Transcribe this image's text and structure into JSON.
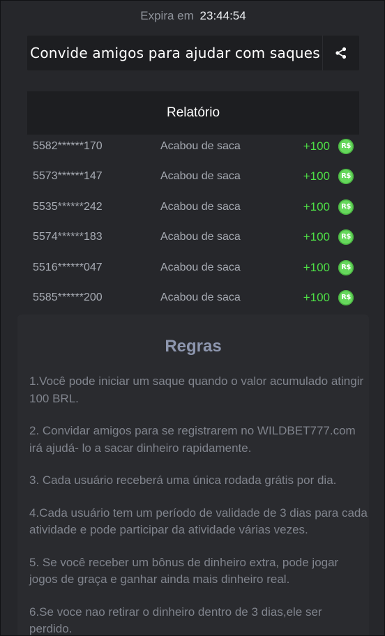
{
  "header": {
    "expira_label": "Expira em",
    "countdown": "23:44:54"
  },
  "invite": {
    "label": "Convide amigos para ajudar com saques",
    "share_icon": "share-icon"
  },
  "report": {
    "title": "Relatório",
    "currency_icon": "R$",
    "rows": [
      {
        "id": "5582******170",
        "status": "Acabou de saca",
        "amount": "+100"
      },
      {
        "id": "5573******147",
        "status": "Acabou de saca",
        "amount": "+100"
      },
      {
        "id": "5535******242",
        "status": "Acabou de saca",
        "amount": "+100"
      },
      {
        "id": "5574******183",
        "status": "Acabou de saca",
        "amount": "+100"
      },
      {
        "id": "5516******047",
        "status": "Acabou de saca",
        "amount": "+100"
      },
      {
        "id": "5585******200",
        "status": "Acabou de saca",
        "amount": "+100"
      }
    ]
  },
  "rules": {
    "title": "Regras",
    "items": [
      "1.Você pode iniciar um saque quando o valor acumulado atingir 100 BRL.",
      "2. Convidar amigos para se registrarem no WILDBET777.com irá ajudá- lo a sacar dinheiro rapidamente.",
      "3. Cada usuário receberá uma única rodada grátis por dia.",
      "4.Cada usuário tem um período de validade de 3 dias para cada atividade e pode participar da atividade várias vezes.",
      "5. Se você receber um bônus de dinheiro extra, pode jogar jogos de graça e ganhar ainda mais dinheiro real.",
      "6.Se voce nao retirar o dinheiro dentro de 3 dias,ele ser perdido."
    ]
  },
  "colors": {
    "background": "#26272b",
    "panel": "#1d1e21",
    "amount_green": "#4ee046",
    "coin_green": "#66d85c",
    "rules_title": "#8d96ae"
  }
}
